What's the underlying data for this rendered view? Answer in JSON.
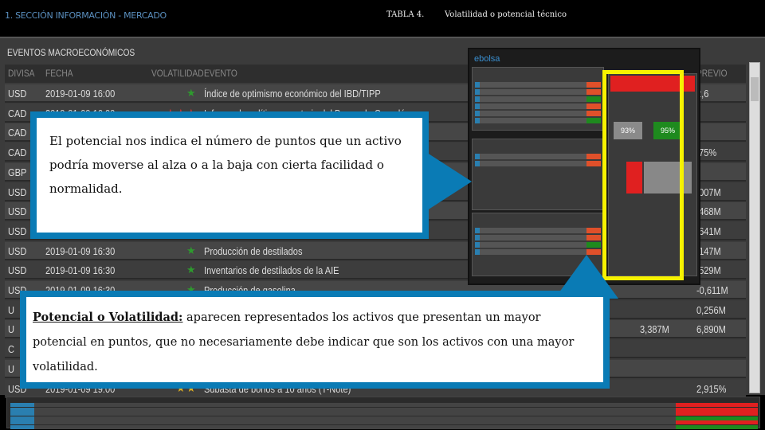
{
  "header": {
    "section": "1. SECCIÓN INFORMACIÓN - MERCADO",
    "table_label": "TABLA 4.",
    "table_title": "Volatilidad o potencial técnico"
  },
  "panel": {
    "title": "EVENTOS MACROECONÓMICOS",
    "columns": {
      "divisa": "DIVISA",
      "fecha": "FECHA",
      "volatilidad": "VOLATILIDAD",
      "evento": "EVENTO",
      "previo": "PREVIO"
    },
    "rows": [
      {
        "divisa": "USD",
        "fecha": "2019-01-09 16:00",
        "stars": 1,
        "color": "#2e9a2e",
        "evento": "Índice de optimismo económico del IBD/TIPP",
        "actual": "",
        "previo": "2,6"
      },
      {
        "divisa": "CAD",
        "fecha": "2019-01-09 16:00",
        "stars": 3,
        "color": "#d9302c",
        "evento": "Informe de política monetaria del Banco de Canadá",
        "actual": "",
        "previo": ""
      },
      {
        "divisa": "CAD",
        "fecha": "",
        "stars": 0,
        "color": "",
        "evento": "",
        "actual": "",
        "previo": ""
      },
      {
        "divisa": "CAD",
        "fecha": "",
        "stars": 0,
        "color": "",
        "evento": "",
        "actual": "",
        "previo": ",75%"
      },
      {
        "divisa": "GBP",
        "fecha": "",
        "stars": 0,
        "color": "",
        "evento": "",
        "actual": "",
        "previo": ""
      },
      {
        "divisa": "USD",
        "fecha": "",
        "stars": 0,
        "color": "",
        "evento": "",
        "actual": "",
        "previo": ",007M"
      },
      {
        "divisa": "USD",
        "fecha": "",
        "stars": 0,
        "color": "",
        "evento": "",
        "actual": "",
        "previo": ",468M"
      },
      {
        "divisa": "USD",
        "fecha": "",
        "stars": 0,
        "color": "",
        "evento": "",
        "actual": "",
        "previo": ",641M"
      },
      {
        "divisa": "USD",
        "fecha": "2019-01-09 16:30",
        "stars": 1,
        "color": "#2e9a2e",
        "evento": "Producción de destilados",
        "actual": "",
        "previo": ",147M"
      },
      {
        "divisa": "USD",
        "fecha": "2019-01-09 16:30",
        "stars": 1,
        "color": "#2e9a2e",
        "evento": "Inventarios de destilados de la AIE",
        "actual": "",
        "previo": ",529M"
      },
      {
        "divisa": "USD",
        "fecha": "2019-01-09 16:30",
        "stars": 1,
        "color": "#2e9a2e",
        "evento": "Producción de gasolina",
        "actual": "",
        "previo": "-0,611M"
      },
      {
        "divisa": "U",
        "fecha": "",
        "stars": 0,
        "color": "",
        "evento": "",
        "actual": "",
        "previo": "0,256M"
      },
      {
        "divisa": "U",
        "fecha": "",
        "stars": 0,
        "color": "",
        "evento": "",
        "actual": "3,387M",
        "previo": "6,890M"
      },
      {
        "divisa": "C",
        "fecha": "",
        "stars": 0,
        "color": "",
        "evento": "",
        "actual": "",
        "previo": ""
      },
      {
        "divisa": "U",
        "fecha": "",
        "stars": 0,
        "color": "",
        "evento": "",
        "actual": "",
        "previo": ""
      },
      {
        "divisa": "USD",
        "fecha": "2019-01-09 19:00",
        "stars": 2,
        "color": "#e0b020",
        "evento": "Subasta de bonos a 10 años (T-Note)",
        "actual": "",
        "previo": "2,915%"
      }
    ]
  },
  "embedded": {
    "brand": "ebolsa",
    "widget_pct_left": "93%",
    "widget_pct_right": "95%"
  },
  "callout1": {
    "text": "El potencial nos indica el número de puntos que un activo podría moverse al alza o a la baja con cierta facilidad o normalidad."
  },
  "callout2": {
    "bold": "Potencial o Volatilidad:",
    "text": " aparecen representados los activos que presentan un mayor potencial en puntos, que no necesariamente debe indicar que son los activos con una mayor volatilidad."
  },
  "colors": {
    "callout_border": "#0a7bb5",
    "highlight": "#f7f200",
    "up": "#1e8a1e",
    "down": "#e02020"
  }
}
